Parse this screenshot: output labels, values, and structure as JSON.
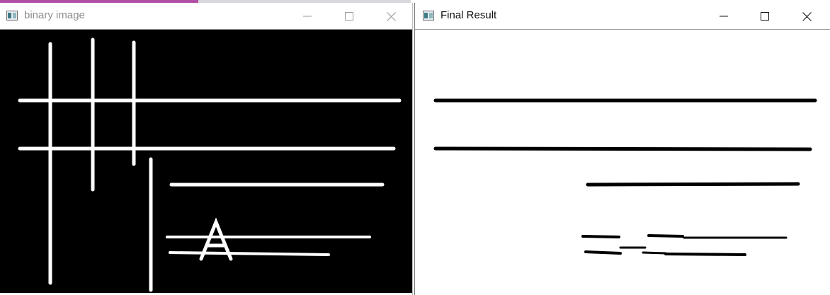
{
  "windows": {
    "left": {
      "title": "binary image",
      "icon": "opencv-window-icon",
      "controls": [
        "minimize-icon",
        "maximize-icon",
        "close-icon"
      ]
    },
    "right": {
      "title": "Final Result",
      "icon": "opencv-window-icon",
      "controls": [
        "minimize-icon",
        "maximize-icon",
        "close-icon"
      ]
    }
  },
  "images": {
    "binary": {
      "background": "#000000",
      "foreground": "#ffffff",
      "letter": "A"
    },
    "result": {
      "background": "#ffffff",
      "foreground": "#000000"
    }
  },
  "colors": {
    "title_active": "#111111",
    "title_inactive": "#8d8d8d",
    "desktop_accent": "#b04fa8"
  }
}
